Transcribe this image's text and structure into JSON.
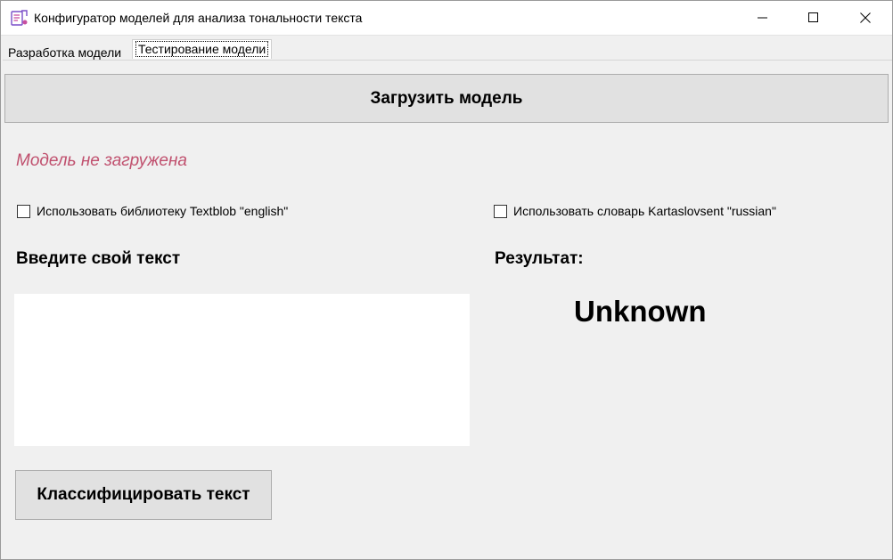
{
  "window": {
    "title": "Конфигуратор моделей для анализа тональности текста",
    "icon": "app-icon",
    "controls": {
      "minimize": "minimize-icon",
      "maximize": "maximize-icon",
      "close": "close-icon"
    }
  },
  "tabs": [
    {
      "label": "Разработка модели",
      "active": false
    },
    {
      "label": "Тестирование модели",
      "active": true
    }
  ],
  "main": {
    "load_button": "Загрузить модель",
    "status": "Модель не загружена",
    "status_color": "#c0506e",
    "checkbox_textblob": {
      "label": "Использовать библиотеку Textblob \"english\"",
      "checked": false
    },
    "checkbox_kartaslovsent": {
      "label": "Использовать словарь Kartaslovsent \"russian\"",
      "checked": false
    },
    "input_heading": "Введите свой текст",
    "text_input": {
      "value": "",
      "placeholder": ""
    },
    "result_heading": "Результат:",
    "result_value": "Unknown",
    "classify_button": "Классифицировать текст"
  }
}
